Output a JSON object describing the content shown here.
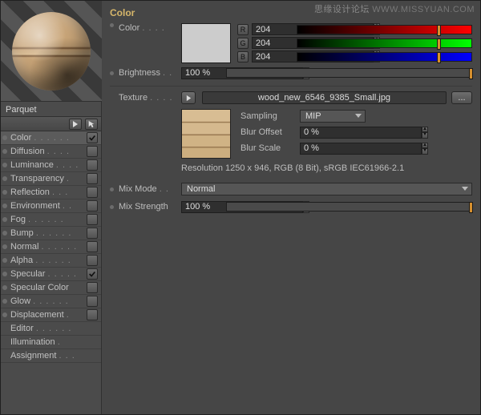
{
  "watermark": {
    "cn": "思缘设计论坛",
    "en": "WWW.MISSYUAN.COM"
  },
  "material_name": "Parquet",
  "channels": [
    {
      "id": "color",
      "label": "Color",
      "checked": true,
      "selected": true,
      "dot": true
    },
    {
      "id": "diffusion",
      "label": "Diffusion",
      "checked": false,
      "dot": true
    },
    {
      "id": "luminance",
      "label": "Luminance",
      "checked": false,
      "dot": true
    },
    {
      "id": "transparency",
      "label": "Transparency",
      "checked": false,
      "dot": true
    },
    {
      "id": "reflection",
      "label": "Reflection",
      "checked": false,
      "dot": true
    },
    {
      "id": "environment",
      "label": "Environment",
      "checked": false,
      "dot": true
    },
    {
      "id": "fog",
      "label": "Fog",
      "checked": false,
      "dot": true
    },
    {
      "id": "bump",
      "label": "Bump",
      "checked": false,
      "dot": true
    },
    {
      "id": "normal",
      "label": "Normal",
      "checked": false,
      "dot": true
    },
    {
      "id": "alpha",
      "label": "Alpha",
      "checked": false,
      "dot": true
    },
    {
      "id": "specular",
      "label": "Specular",
      "checked": true,
      "dot": true
    },
    {
      "id": "specular-color",
      "label": "Specular Color",
      "checked": false,
      "dot": true
    },
    {
      "id": "glow",
      "label": "Glow",
      "checked": false,
      "dot": true
    },
    {
      "id": "displacement",
      "label": "Displacement",
      "checked": false,
      "dot": true
    },
    {
      "id": "editor",
      "label": "Editor",
      "noswitch": true
    },
    {
      "id": "illumination",
      "label": "Illumination",
      "noswitch": true
    },
    {
      "id": "assignment",
      "label": "Assignment",
      "noswitch": true
    }
  ],
  "panel": {
    "title": "Color",
    "color": {
      "label": "Color",
      "r": "204",
      "g": "204",
      "b": "204"
    },
    "brightness": {
      "label": "Brightness",
      "value": "100 %"
    },
    "texture": {
      "label": "Texture",
      "file": "wood_new_6546_9385_Small.jpg",
      "sampling": {
        "label": "Sampling",
        "value": "MIP"
      },
      "blur_offset": {
        "label": "Blur Offset",
        "value": "0 %"
      },
      "blur_scale": {
        "label": "Blur Scale",
        "value": "0 %"
      },
      "resolution": "Resolution 1250 x 946, RGB (8 Bit), sRGB IEC61966-2.1"
    },
    "mix_mode": {
      "label": "Mix Mode",
      "value": "Normal"
    },
    "mix_strength": {
      "label": "Mix Strength",
      "value": "100 %"
    }
  },
  "chips": {
    "r": "R",
    "g": "G",
    "b": "B",
    "more": "..."
  }
}
